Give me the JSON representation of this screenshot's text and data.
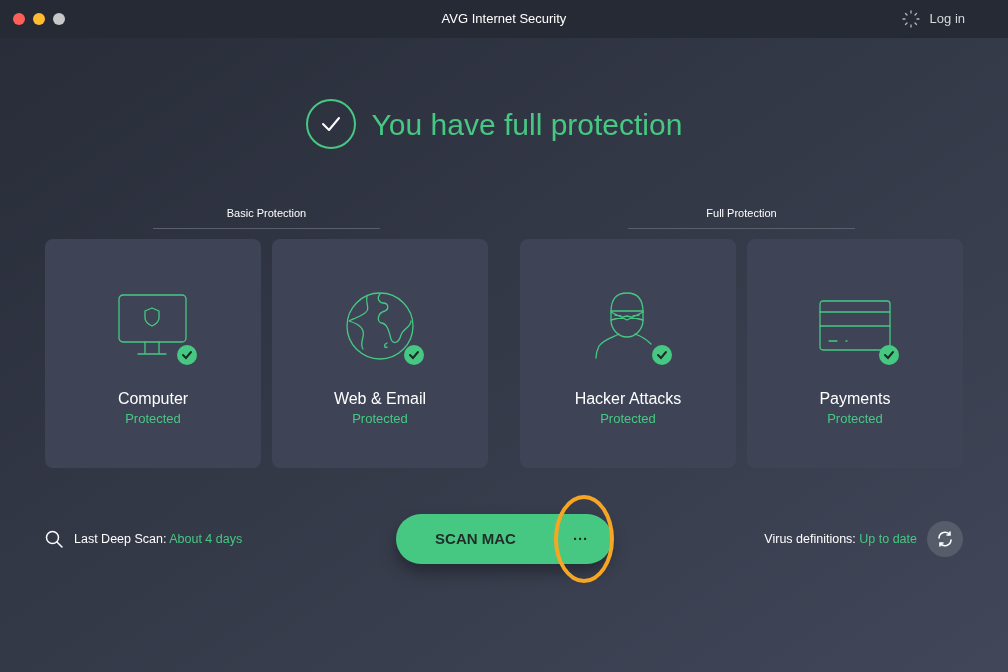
{
  "window": {
    "title": "AVG Internet Security",
    "login": "Log in"
  },
  "headline": "You have full protection",
  "sections": [
    {
      "label": "Basic Protection",
      "cards": [
        {
          "kind": "computer",
          "title": "Computer",
          "status": "Protected",
          "protected": true
        },
        {
          "kind": "globe",
          "title": "Web & Email",
          "status": "Protected",
          "protected": true
        }
      ]
    },
    {
      "label": "Full Protection",
      "cards": [
        {
          "kind": "hacker",
          "title": "Hacker Attacks",
          "status": "Protected",
          "protected": true
        },
        {
          "kind": "card",
          "title": "Payments",
          "status": "Protected",
          "protected": true
        }
      ]
    }
  ],
  "last_scan": {
    "label": "Last Deep Scan:",
    "value": "About 4 days"
  },
  "scan_button": {
    "label": "SCAN MAC",
    "more": "···",
    "highlighted": true
  },
  "definitions": {
    "label": "Virus definitions:",
    "value": "Up to date"
  }
}
